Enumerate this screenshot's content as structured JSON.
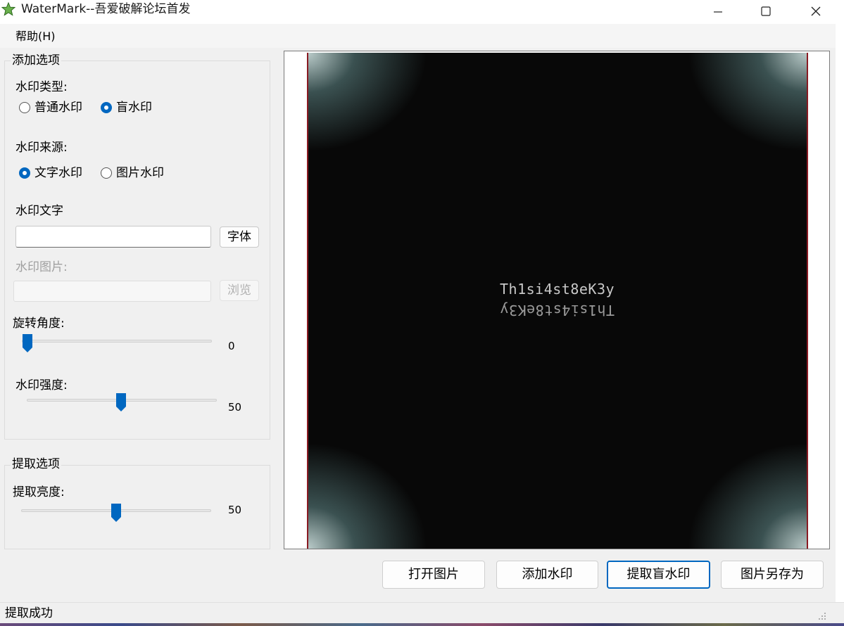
{
  "window": {
    "title": "WaterMark--吾爱破解论坛首发",
    "icon": "star-icon"
  },
  "menu": {
    "help": "帮助(H)"
  },
  "add_options": {
    "group_title": "添加选项",
    "type_label": "水印类型:",
    "type_options": [
      {
        "label": "普通水印",
        "checked": false
      },
      {
        "label": "盲水印",
        "checked": true
      }
    ],
    "source_label": "水印来源:",
    "source_options": [
      {
        "label": "文字水印",
        "checked": true
      },
      {
        "label": "图片水印",
        "checked": false
      }
    ],
    "text_label": "水印文字",
    "text_value": "",
    "font_button": "字体",
    "image_label": "水印图片:",
    "image_value": "",
    "browse_button": "浏览",
    "rotation_label": "旋转角度:",
    "rotation_value": "0",
    "strength_label": "水印强度:",
    "strength_value": "50"
  },
  "extract_options": {
    "group_title": "提取选项",
    "brightness_label": "提取亮度:",
    "brightness_value": "50"
  },
  "preview": {
    "watermark_text": "Th1si4st8eK3y",
    "watermark_text_mirrored": "Th1si4st8eK3y"
  },
  "buttons": {
    "open": "打开图片",
    "add": "添加水印",
    "extract": "提取盲水印",
    "save_as": "图片另存为"
  },
  "status": "提取成功",
  "colors": {
    "accent": "#0067c0",
    "window_bg": "#f0f0f0"
  }
}
